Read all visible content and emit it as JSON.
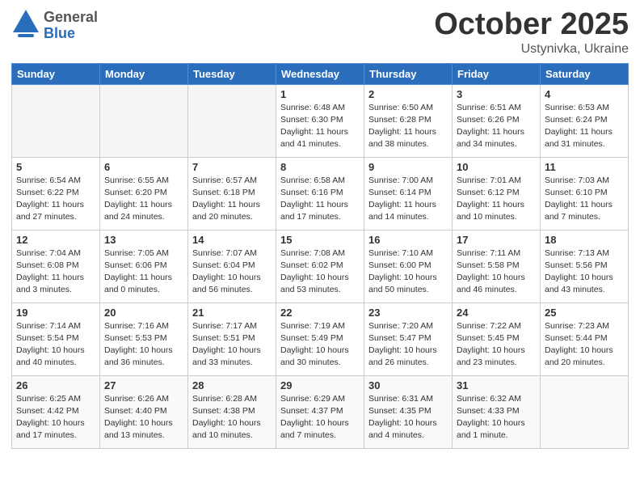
{
  "header": {
    "logo_general": "General",
    "logo_blue": "Blue",
    "month": "October 2025",
    "location": "Ustynivka, Ukraine"
  },
  "weekdays": [
    "Sunday",
    "Monday",
    "Tuesday",
    "Wednesday",
    "Thursday",
    "Friday",
    "Saturday"
  ],
  "weeks": [
    [
      {
        "day": "",
        "info": ""
      },
      {
        "day": "",
        "info": ""
      },
      {
        "day": "",
        "info": ""
      },
      {
        "day": "1",
        "info": "Sunrise: 6:48 AM\nSunset: 6:30 PM\nDaylight: 11 hours\nand 41 minutes."
      },
      {
        "day": "2",
        "info": "Sunrise: 6:50 AM\nSunset: 6:28 PM\nDaylight: 11 hours\nand 38 minutes."
      },
      {
        "day": "3",
        "info": "Sunrise: 6:51 AM\nSunset: 6:26 PM\nDaylight: 11 hours\nand 34 minutes."
      },
      {
        "day": "4",
        "info": "Sunrise: 6:53 AM\nSunset: 6:24 PM\nDaylight: 11 hours\nand 31 minutes."
      }
    ],
    [
      {
        "day": "5",
        "info": "Sunrise: 6:54 AM\nSunset: 6:22 PM\nDaylight: 11 hours\nand 27 minutes."
      },
      {
        "day": "6",
        "info": "Sunrise: 6:55 AM\nSunset: 6:20 PM\nDaylight: 11 hours\nand 24 minutes."
      },
      {
        "day": "7",
        "info": "Sunrise: 6:57 AM\nSunset: 6:18 PM\nDaylight: 11 hours\nand 20 minutes."
      },
      {
        "day": "8",
        "info": "Sunrise: 6:58 AM\nSunset: 6:16 PM\nDaylight: 11 hours\nand 17 minutes."
      },
      {
        "day": "9",
        "info": "Sunrise: 7:00 AM\nSunset: 6:14 PM\nDaylight: 11 hours\nand 14 minutes."
      },
      {
        "day": "10",
        "info": "Sunrise: 7:01 AM\nSunset: 6:12 PM\nDaylight: 11 hours\nand 10 minutes."
      },
      {
        "day": "11",
        "info": "Sunrise: 7:03 AM\nSunset: 6:10 PM\nDaylight: 11 hours\nand 7 minutes."
      }
    ],
    [
      {
        "day": "12",
        "info": "Sunrise: 7:04 AM\nSunset: 6:08 PM\nDaylight: 11 hours\nand 3 minutes."
      },
      {
        "day": "13",
        "info": "Sunrise: 7:05 AM\nSunset: 6:06 PM\nDaylight: 11 hours\nand 0 minutes."
      },
      {
        "day": "14",
        "info": "Sunrise: 7:07 AM\nSunset: 6:04 PM\nDaylight: 10 hours\nand 56 minutes."
      },
      {
        "day": "15",
        "info": "Sunrise: 7:08 AM\nSunset: 6:02 PM\nDaylight: 10 hours\nand 53 minutes."
      },
      {
        "day": "16",
        "info": "Sunrise: 7:10 AM\nSunset: 6:00 PM\nDaylight: 10 hours\nand 50 minutes."
      },
      {
        "day": "17",
        "info": "Sunrise: 7:11 AM\nSunset: 5:58 PM\nDaylight: 10 hours\nand 46 minutes."
      },
      {
        "day": "18",
        "info": "Sunrise: 7:13 AM\nSunset: 5:56 PM\nDaylight: 10 hours\nand 43 minutes."
      }
    ],
    [
      {
        "day": "19",
        "info": "Sunrise: 7:14 AM\nSunset: 5:54 PM\nDaylight: 10 hours\nand 40 minutes."
      },
      {
        "day": "20",
        "info": "Sunrise: 7:16 AM\nSunset: 5:53 PM\nDaylight: 10 hours\nand 36 minutes."
      },
      {
        "day": "21",
        "info": "Sunrise: 7:17 AM\nSunset: 5:51 PM\nDaylight: 10 hours\nand 33 minutes."
      },
      {
        "day": "22",
        "info": "Sunrise: 7:19 AM\nSunset: 5:49 PM\nDaylight: 10 hours\nand 30 minutes."
      },
      {
        "day": "23",
        "info": "Sunrise: 7:20 AM\nSunset: 5:47 PM\nDaylight: 10 hours\nand 26 minutes."
      },
      {
        "day": "24",
        "info": "Sunrise: 7:22 AM\nSunset: 5:45 PM\nDaylight: 10 hours\nand 23 minutes."
      },
      {
        "day": "25",
        "info": "Sunrise: 7:23 AM\nSunset: 5:44 PM\nDaylight: 10 hours\nand 20 minutes."
      }
    ],
    [
      {
        "day": "26",
        "info": "Sunrise: 6:25 AM\nSunset: 4:42 PM\nDaylight: 10 hours\nand 17 minutes."
      },
      {
        "day": "27",
        "info": "Sunrise: 6:26 AM\nSunset: 4:40 PM\nDaylight: 10 hours\nand 13 minutes."
      },
      {
        "day": "28",
        "info": "Sunrise: 6:28 AM\nSunset: 4:38 PM\nDaylight: 10 hours\nand 10 minutes."
      },
      {
        "day": "29",
        "info": "Sunrise: 6:29 AM\nSunset: 4:37 PM\nDaylight: 10 hours\nand 7 minutes."
      },
      {
        "day": "30",
        "info": "Sunrise: 6:31 AM\nSunset: 4:35 PM\nDaylight: 10 hours\nand 4 minutes."
      },
      {
        "day": "31",
        "info": "Sunrise: 6:32 AM\nSunset: 4:33 PM\nDaylight: 10 hours\nand 1 minute."
      },
      {
        "day": "",
        "info": ""
      }
    ]
  ]
}
